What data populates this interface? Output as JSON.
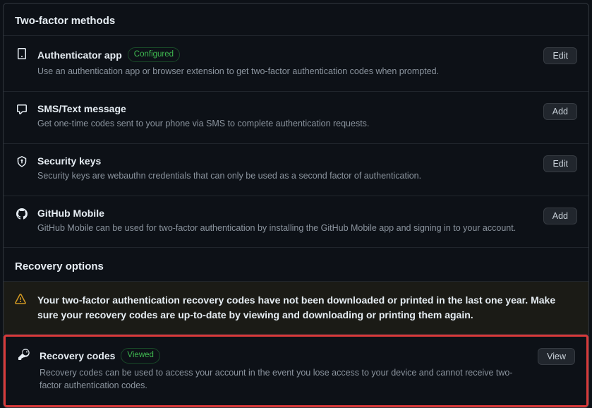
{
  "sections": {
    "methods_header": "Two-factor methods",
    "recovery_header": "Recovery options"
  },
  "methods": {
    "authenticator": {
      "title": "Authenticator app",
      "badge": "Configured",
      "desc": "Use an authentication app or browser extension to get two-factor authentication codes when prompted.",
      "action": "Edit"
    },
    "sms": {
      "title": "SMS/Text message",
      "desc": "Get one-time codes sent to your phone via SMS to complete authentication requests.",
      "action": "Add"
    },
    "keys": {
      "title": "Security keys",
      "desc": "Security keys are webauthn credentials that can only be used as a second factor of authentication.",
      "action": "Edit"
    },
    "mobile": {
      "title": "GitHub Mobile",
      "desc": "GitHub Mobile can be used for two-factor authentication by installing the GitHub Mobile app and signing in to your account.",
      "action": "Add"
    }
  },
  "recovery": {
    "warning": "Your two-factor authentication recovery codes have not been downloaded or printed in the last one year. Make sure your recovery codes are up-to-date by viewing and downloading or printing them again.",
    "codes": {
      "title": "Recovery codes",
      "badge": "Viewed",
      "desc": "Recovery codes can be used to access your account in the event you lose access to your device and cannot receive two-factor authentication codes.",
      "action": "View"
    }
  }
}
